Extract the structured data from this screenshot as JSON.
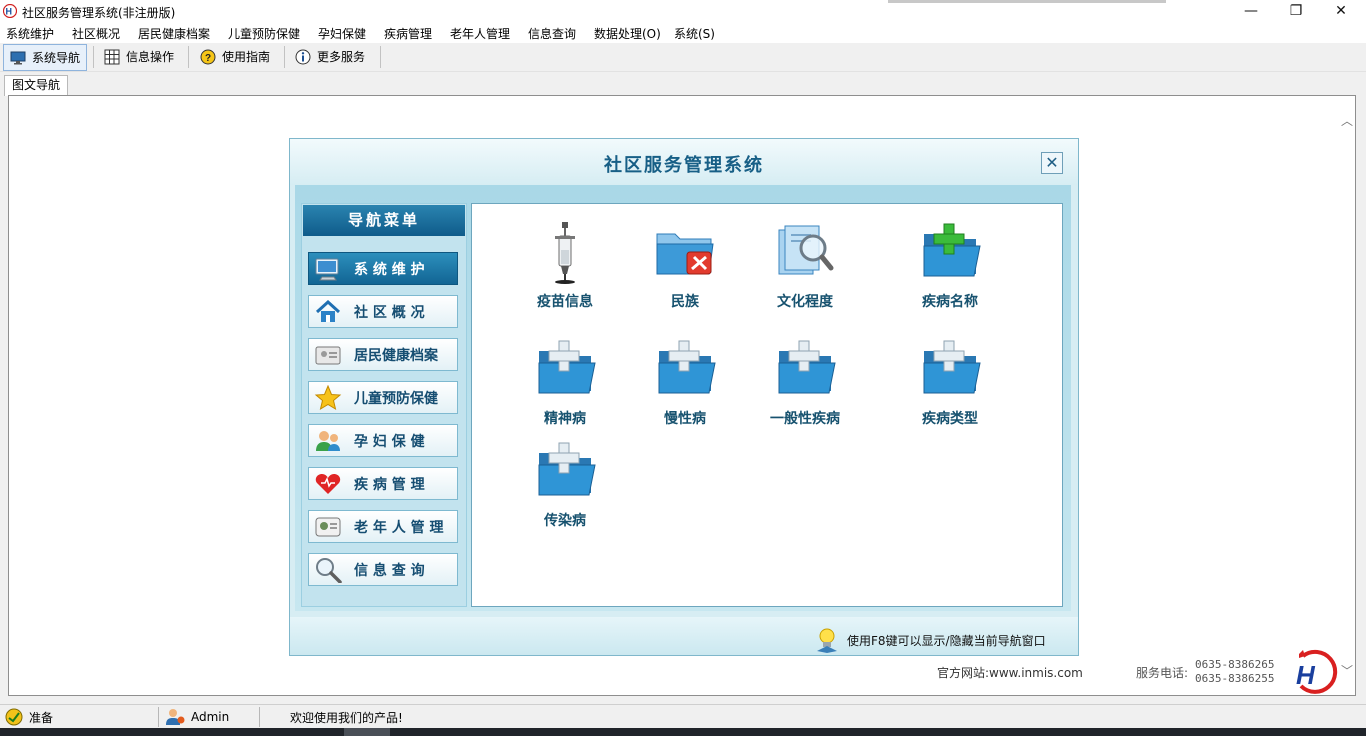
{
  "window": {
    "title": "社区服务管理系统(非注册版)",
    "minimize_glyph": "—",
    "restore_glyph": "❐",
    "close_glyph": "✕"
  },
  "menu": [
    "系统维护",
    "社区概况",
    "居民健康档案",
    "儿童预防保健",
    "孕妇保健",
    "疾病管理",
    "老年人管理",
    "信息查询",
    "数据处理(O)",
    "系统(S)"
  ],
  "toolbar": {
    "items": [
      {
        "label": "系统导航",
        "icon": "monitor-icon"
      },
      {
        "label": "信息操作",
        "icon": "grid-icon"
      },
      {
        "label": "使用指南",
        "icon": "help-icon"
      },
      {
        "label": "更多服务",
        "icon": "info-icon"
      }
    ]
  },
  "tab": {
    "label": "图文导航"
  },
  "dialog": {
    "title": "社区服务管理系统",
    "close_glyph": "✕",
    "nav_title": "导航菜单",
    "nav_items": [
      {
        "label": "系 统 维 护",
        "icon": "monitor-icon",
        "active": true
      },
      {
        "label": "社 区 概 况",
        "icon": "home-icon"
      },
      {
        "label": "居民健康档案",
        "icon": "id-card-icon"
      },
      {
        "label": "儿童预防保健",
        "icon": "star-icon"
      },
      {
        "label": "孕 妇 保 健",
        "icon": "people-icon"
      },
      {
        "label": "疾 病 管 理",
        "icon": "heart-icon"
      },
      {
        "label": "老 年 人 管 理",
        "icon": "elder-card-icon"
      },
      {
        "label": "信 息 查 询",
        "icon": "magnifier-icon"
      }
    ],
    "content_items": [
      {
        "label": "疫苗信息",
        "icon": "syringe-icon"
      },
      {
        "label": "民族",
        "icon": "folder-tools-icon"
      },
      {
        "label": "文化程度",
        "icon": "document-search-icon"
      },
      {
        "label": "疾病名称",
        "icon": "folder-plus-green-icon"
      },
      {
        "label": "精神病",
        "icon": "folder-plus-icon"
      },
      {
        "label": "慢性病",
        "icon": "folder-plus-icon"
      },
      {
        "label": "一般性疾病",
        "icon": "folder-plus-icon"
      },
      {
        "label": "疾病类型",
        "icon": "folder-plus-icon"
      },
      {
        "label": "传染病",
        "icon": "folder-plus-icon"
      }
    ],
    "footer_tip": "使用F8键可以显示/隐藏当前导航窗口"
  },
  "info": {
    "website": "官方网站:www.inmis.com",
    "phone_label": "服务电话:",
    "phones": [
      "0635-8386265",
      "0635-8386255"
    ]
  },
  "status": {
    "ready": "准备",
    "user": "Admin",
    "welcome": "欢迎使用我们的产品!"
  },
  "colors": {
    "accent": "#175f86",
    "nav_active": "#1a72a2",
    "dialog_bg": "#d7edf3"
  }
}
